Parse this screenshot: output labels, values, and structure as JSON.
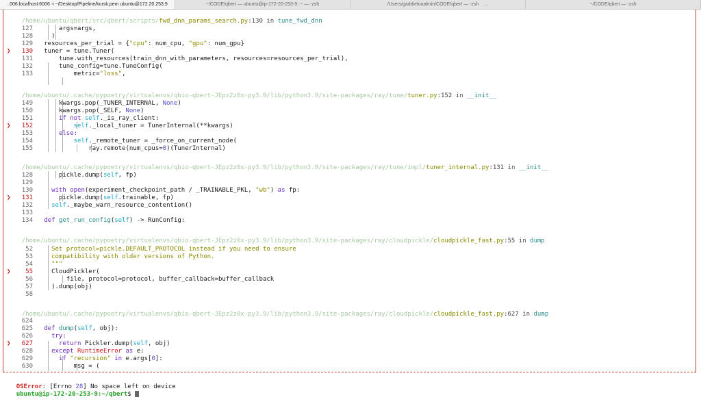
{
  "tabs": [
    {
      "label": "..006:localhost:6006 -i ~/Desktop/Pipeline/kursk.pem ubuntu@172.20.253.9",
      "active": true
    },
    {
      "label": "~/CODE/qbert — ubuntu@ip-172-20-253-9: ~ — -zsh"
    },
    {
      "label": "/Users/gaddielouaknin/CODE/qbert — -zsh",
      "dots": "..."
    },
    {
      "label": "~/CODE/qbert — -zsh"
    }
  ],
  "frames": {
    "f1": {
      "path": "/home/ubuntu/qbert/src/qbert/scripts/",
      "file": "fwd_dnn_params_search.py",
      "line": ":130",
      "in": " in ",
      "func": "tune_fwd_dnn"
    },
    "f2": {
      "path": "/home/ubuntu/.cache/pypoetry/virtualenvs/qbio-qbert-JEpz2z0x-py3.9/lib/python3.9/site-packages/ray/tune/",
      "file": "tuner.py",
      "line": ":152",
      "in": " in ",
      "func": "__init__"
    },
    "f3": {
      "path": "/home/ubuntu/.cache/pypoetry/virtualenvs/qbio-qbert-JEpz2z0x-py3.9/lib/python3.9/site-packages/ray/tune/impl/",
      "file": "tuner_internal.py",
      "line": ":131",
      "in": " in ",
      "func": "__init__"
    },
    "f4": {
      "path": "/home/ubuntu/.cache/pypoetry/virtualenvs/qbio-qbert-JEpz2z0x-py3.9/lib/python3.9/site-packages/ray/cloudpickle/",
      "file": "cloudpickle_fast.py",
      "line": ":55",
      "in": " in ",
      "func": "dump"
    },
    "f5": {
      "path": "/home/ubuntu/.cache/pypoetry/virtualenvs/qbio-qbert-JEpz2z0x-py3.9/lib/python3.9/site-packages/ray/cloudpickle/",
      "file": "cloudpickle_fast.py",
      "line": ":627",
      "in": " in ",
      "func": "dump"
    }
  },
  "code": {
    "l127": "args=args,",
    "l128": ")",
    "l129a": "resources_per_trial = {",
    "l129b": "\"cpu\"",
    "l129c": ": num_cpu, ",
    "l129d": "\"gpu\"",
    "l129e": ": num_gpu}",
    "l130": "tuner = tune.Tuner(",
    "l131": "tune.with_resources(train_dnn_with_parameters, resources=resources_per_trial),",
    "l132": "tune_config=tune.TuneConfig(",
    "l133a": "metric=",
    "l133b": "\"loss\"",
    "l133c": ",",
    "l149a": "kwargs.pop(_TUNER_INTERNAL, ",
    "l149b": "None",
    "l149c": ")",
    "l150a": "kwargs.pop(_SELF, ",
    "l150b": "None",
    "l150c": ")",
    "l151a": "if not ",
    "l151b": "self",
    "l151c": "._is_ray_client:",
    "l152a": "self",
    "l152b": "._local_tuner = TunerInternal(**kwargs)",
    "l153": "else:",
    "l154a": "self",
    "l154b": "._remote_tuner = _force_on_current_node(",
    "l155a": "ray.remote(num_cpus=",
    "l155b": "0",
    "l155c": ")(TunerInternal)",
    "t128a": "pickle.dump(",
    "t128b": "self",
    "t128c": ", fp)",
    "t130a": "with ",
    "t130b": "open",
    "t130c": "(experiment_checkpoint_path / _TRAINABLE_PKL, ",
    "t130d": "\"wb\"",
    "t130e": ") ",
    "t130f": "as",
    "t130g": " fp:",
    "t131a": "pickle.dump(",
    "t131b": "self",
    "t131c": ".trainable, fp)",
    "t132a": "self",
    "t132b": "._maybe_warn_resource_contention()",
    "t134a": "def ",
    "t134b": "get_run_config",
    "t134c": "(",
    "t134d": "self",
    "t134e": ") -> RunConfig:",
    "c52": "Set protocol=pickle.DEFAULT_PROTOCOL instead if you need to ensure",
    "c53": "compatibility with older versions of Python.",
    "c54": "\"\"\"",
    "c55": "CloudPickler(",
    "c56": "file, protocol=protocol, buffer_callback=buffer_callback",
    "c57": ").dump(obj)",
    "d625a": "def ",
    "d625b": "dump",
    "d625c": "(",
    "d625d": "self",
    "d625e": ", obj):",
    "d626": "try:",
    "d627a": "return ",
    "d627b": "Pickler.dump(",
    "d627c": "self",
    "d627d": ", obj)",
    "d628a": "except ",
    "d628b": "RuntimeError",
    "d628c": " as ",
    "d628d": "e:",
    "d629a": "if ",
    "d629b": "\"recursion\"",
    "d629c": " in ",
    "d629d": "e.args[",
    "d629e": "0",
    "d629f": "]:",
    "d630": "msg = ("
  },
  "lines": {
    "n127": "127",
    "n128": "128",
    "n129": "129",
    "n130": "130",
    "n131": "131",
    "n132": "132",
    "n133": "133",
    "n149": "149",
    "n150": "150",
    "n151": "151",
    "n152": "152",
    "n153": "153",
    "n154": "154",
    "n155": "155",
    "m128": "128",
    "m129": "129",
    "m130": "130",
    "m131": "131",
    "m132": "132",
    "m133": "133",
    "m134": "134",
    "k52": "52",
    "k53": "53",
    "k54": "54",
    "k55": "55",
    "k56": "56",
    "k57": "57",
    "k58": "58",
    "p624": "624",
    "p625": "625",
    "p626": "626",
    "p627": "627",
    "p628": "628",
    "p629": "629",
    "p630": "630"
  },
  "marker": "❯",
  "error": {
    "type": "OSError",
    "sep": ": [Errno ",
    "code": "28",
    "msg": "] No space left on device"
  },
  "prompt": {
    "user_host": "ubuntu@ip-172-20-253-9",
    "path": ":~/qbert",
    "symbol": "$ "
  },
  "colors": {
    "accent": "#c0342a",
    "keyword": "#6a28c0",
    "self": "#1fa8c9",
    "string": "#8a8a00",
    "prompt": "#22a022"
  }
}
